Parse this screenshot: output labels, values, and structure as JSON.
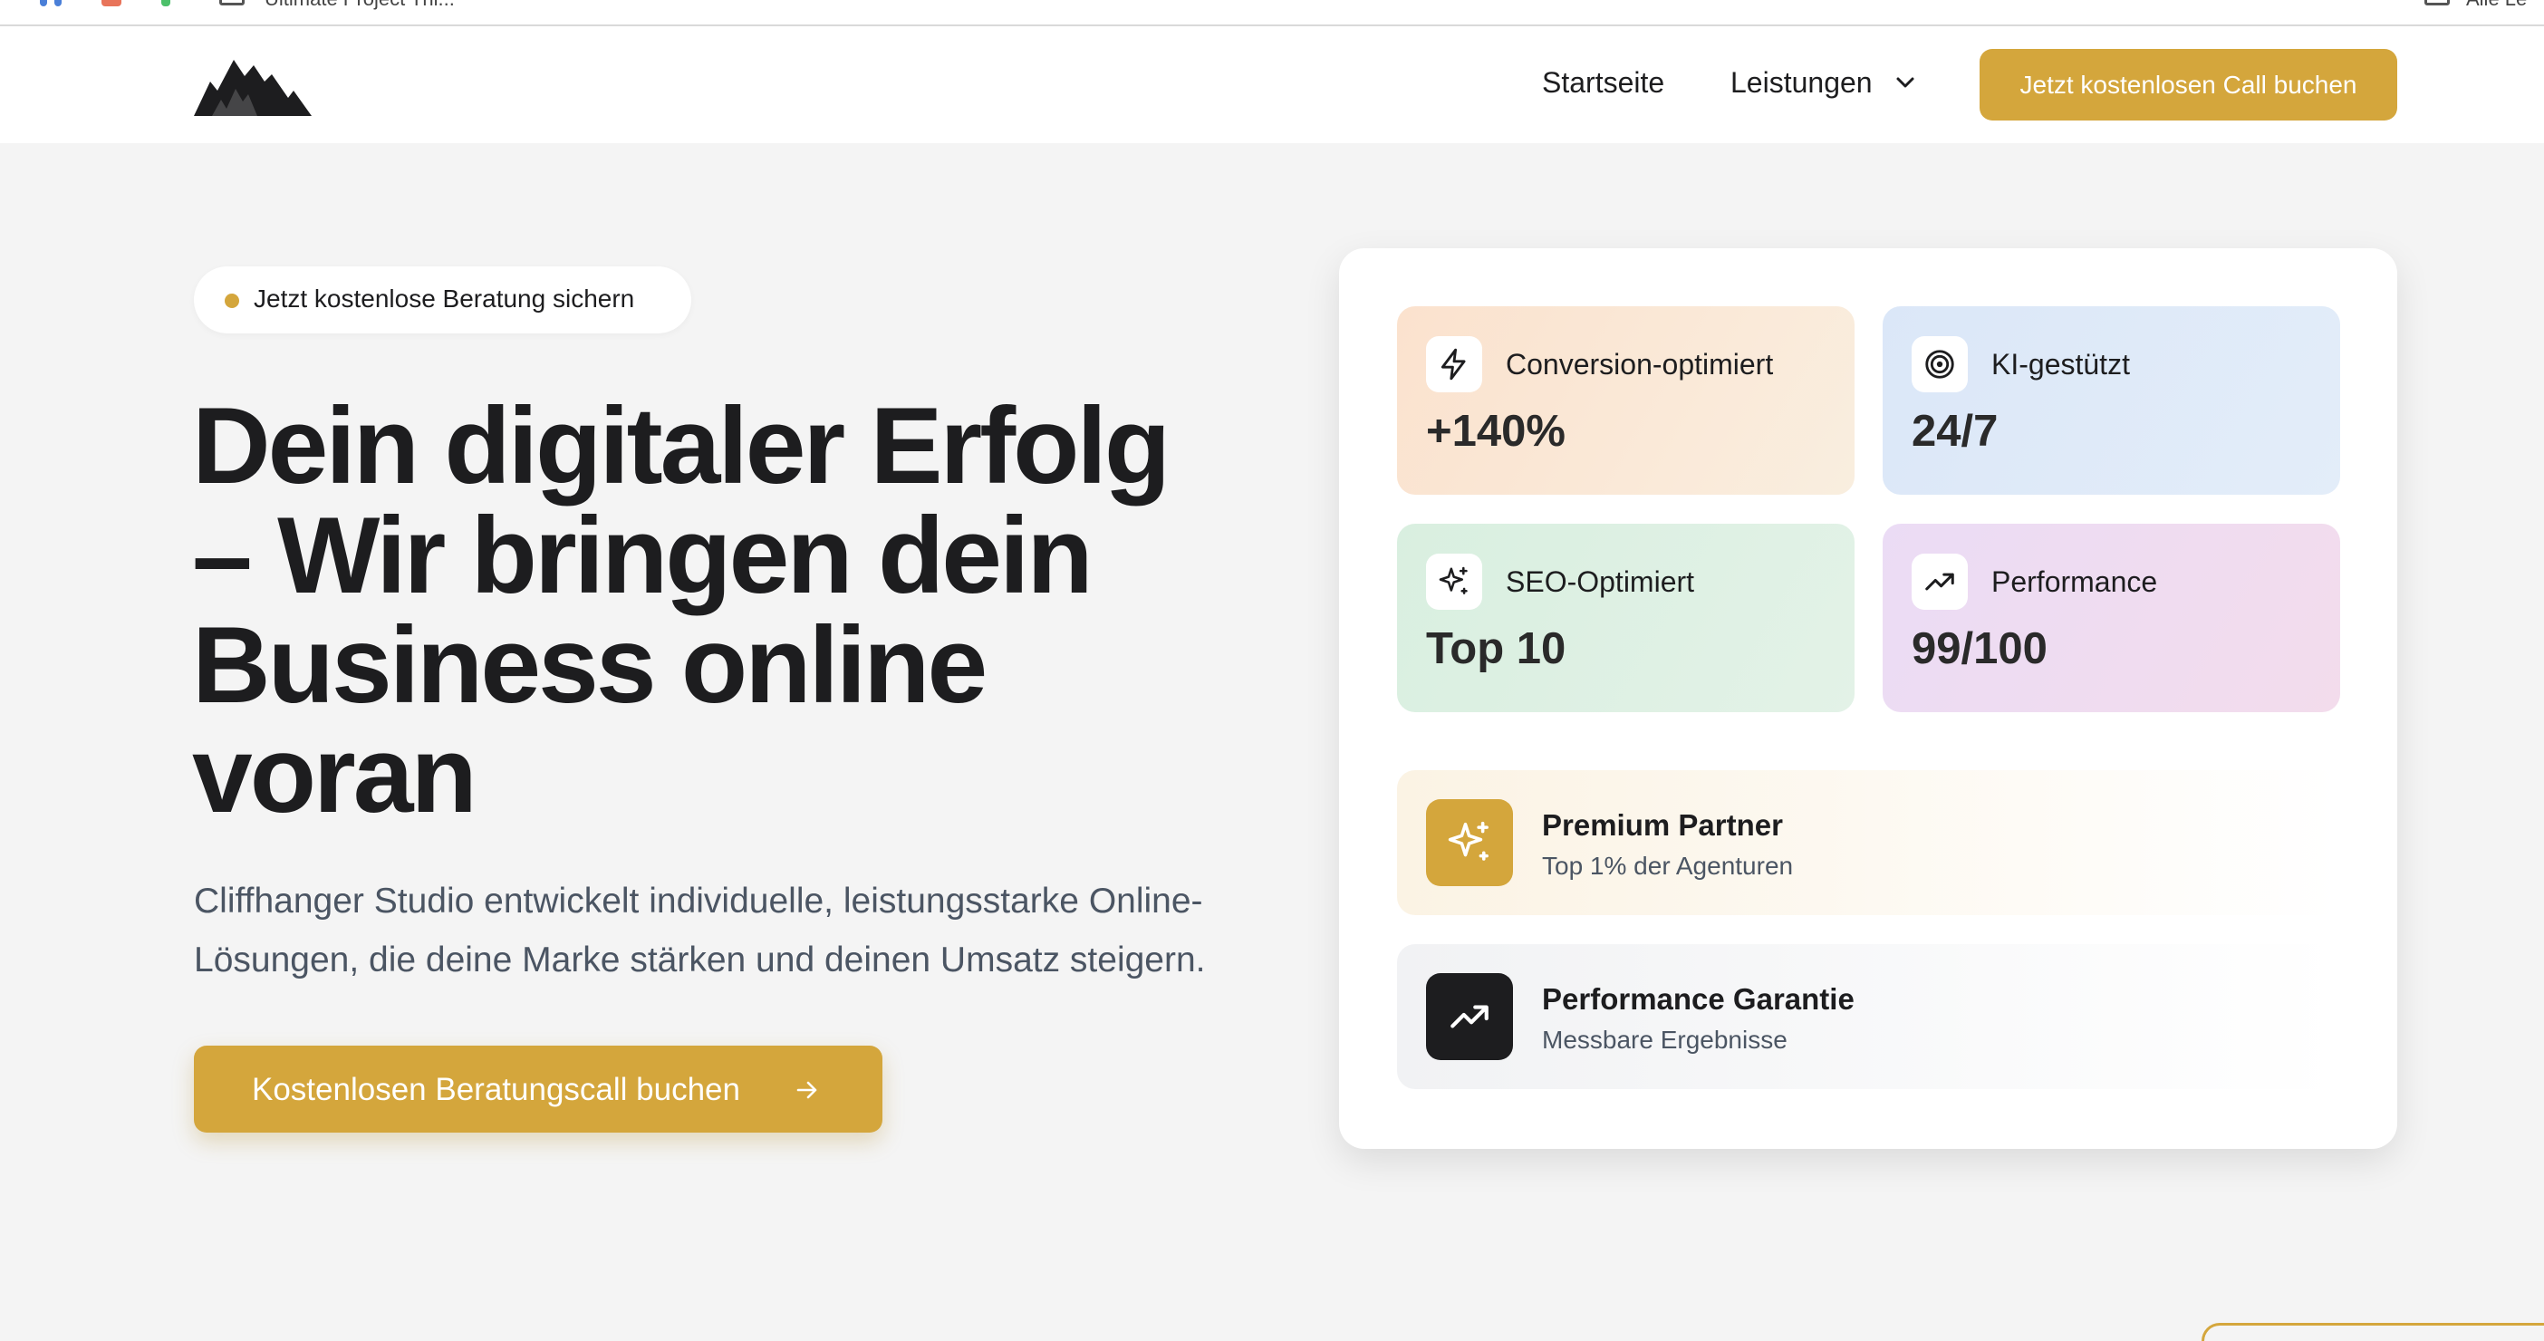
{
  "bookmarks": {
    "project_label": "Ultimate Project Thi...",
    "right_label": "Alle Le"
  },
  "nav": {
    "links": [
      "Startseite",
      "Leistungen"
    ],
    "cta": "Jetzt kostenlosen Call buchen"
  },
  "hero": {
    "badge": "Jetzt kostenlose Beratung sichern",
    "headline_lines": [
      "Dein digitaler Erfolg",
      "– Wir bringen dein",
      "Business online",
      "voran"
    ],
    "subtext_lines": [
      "Cliffhanger Studio entwickelt individuelle, leistungsstarke Online-",
      "Lösungen, die deine Marke stärken und deinen Umsatz steigern."
    ],
    "cta": "Kostenlosen Beratungscall buchen"
  },
  "stats": [
    {
      "icon": "lightning-icon",
      "label": "Conversion-optimiert",
      "value": "+140%"
    },
    {
      "icon": "target-icon",
      "label": "KI-gestützt",
      "value": "24/7"
    },
    {
      "icon": "sparkle-icon",
      "label": "SEO-Optimiert",
      "value": "Top 10"
    },
    {
      "icon": "trend-up-icon",
      "label": "Performance",
      "value": "99/100"
    }
  ],
  "features": [
    {
      "icon": "sparkle-icon",
      "title": "Premium Partner",
      "subtitle": "Top 1% der Agenturen"
    },
    {
      "icon": "trend-up-icon",
      "title": "Performance Garantie",
      "subtitle": "Messbare Ergebnisse"
    }
  ],
  "colors": {
    "accent": "#d4a63c",
    "dark": "#1d1d1f",
    "background": "#f4f4f4"
  }
}
